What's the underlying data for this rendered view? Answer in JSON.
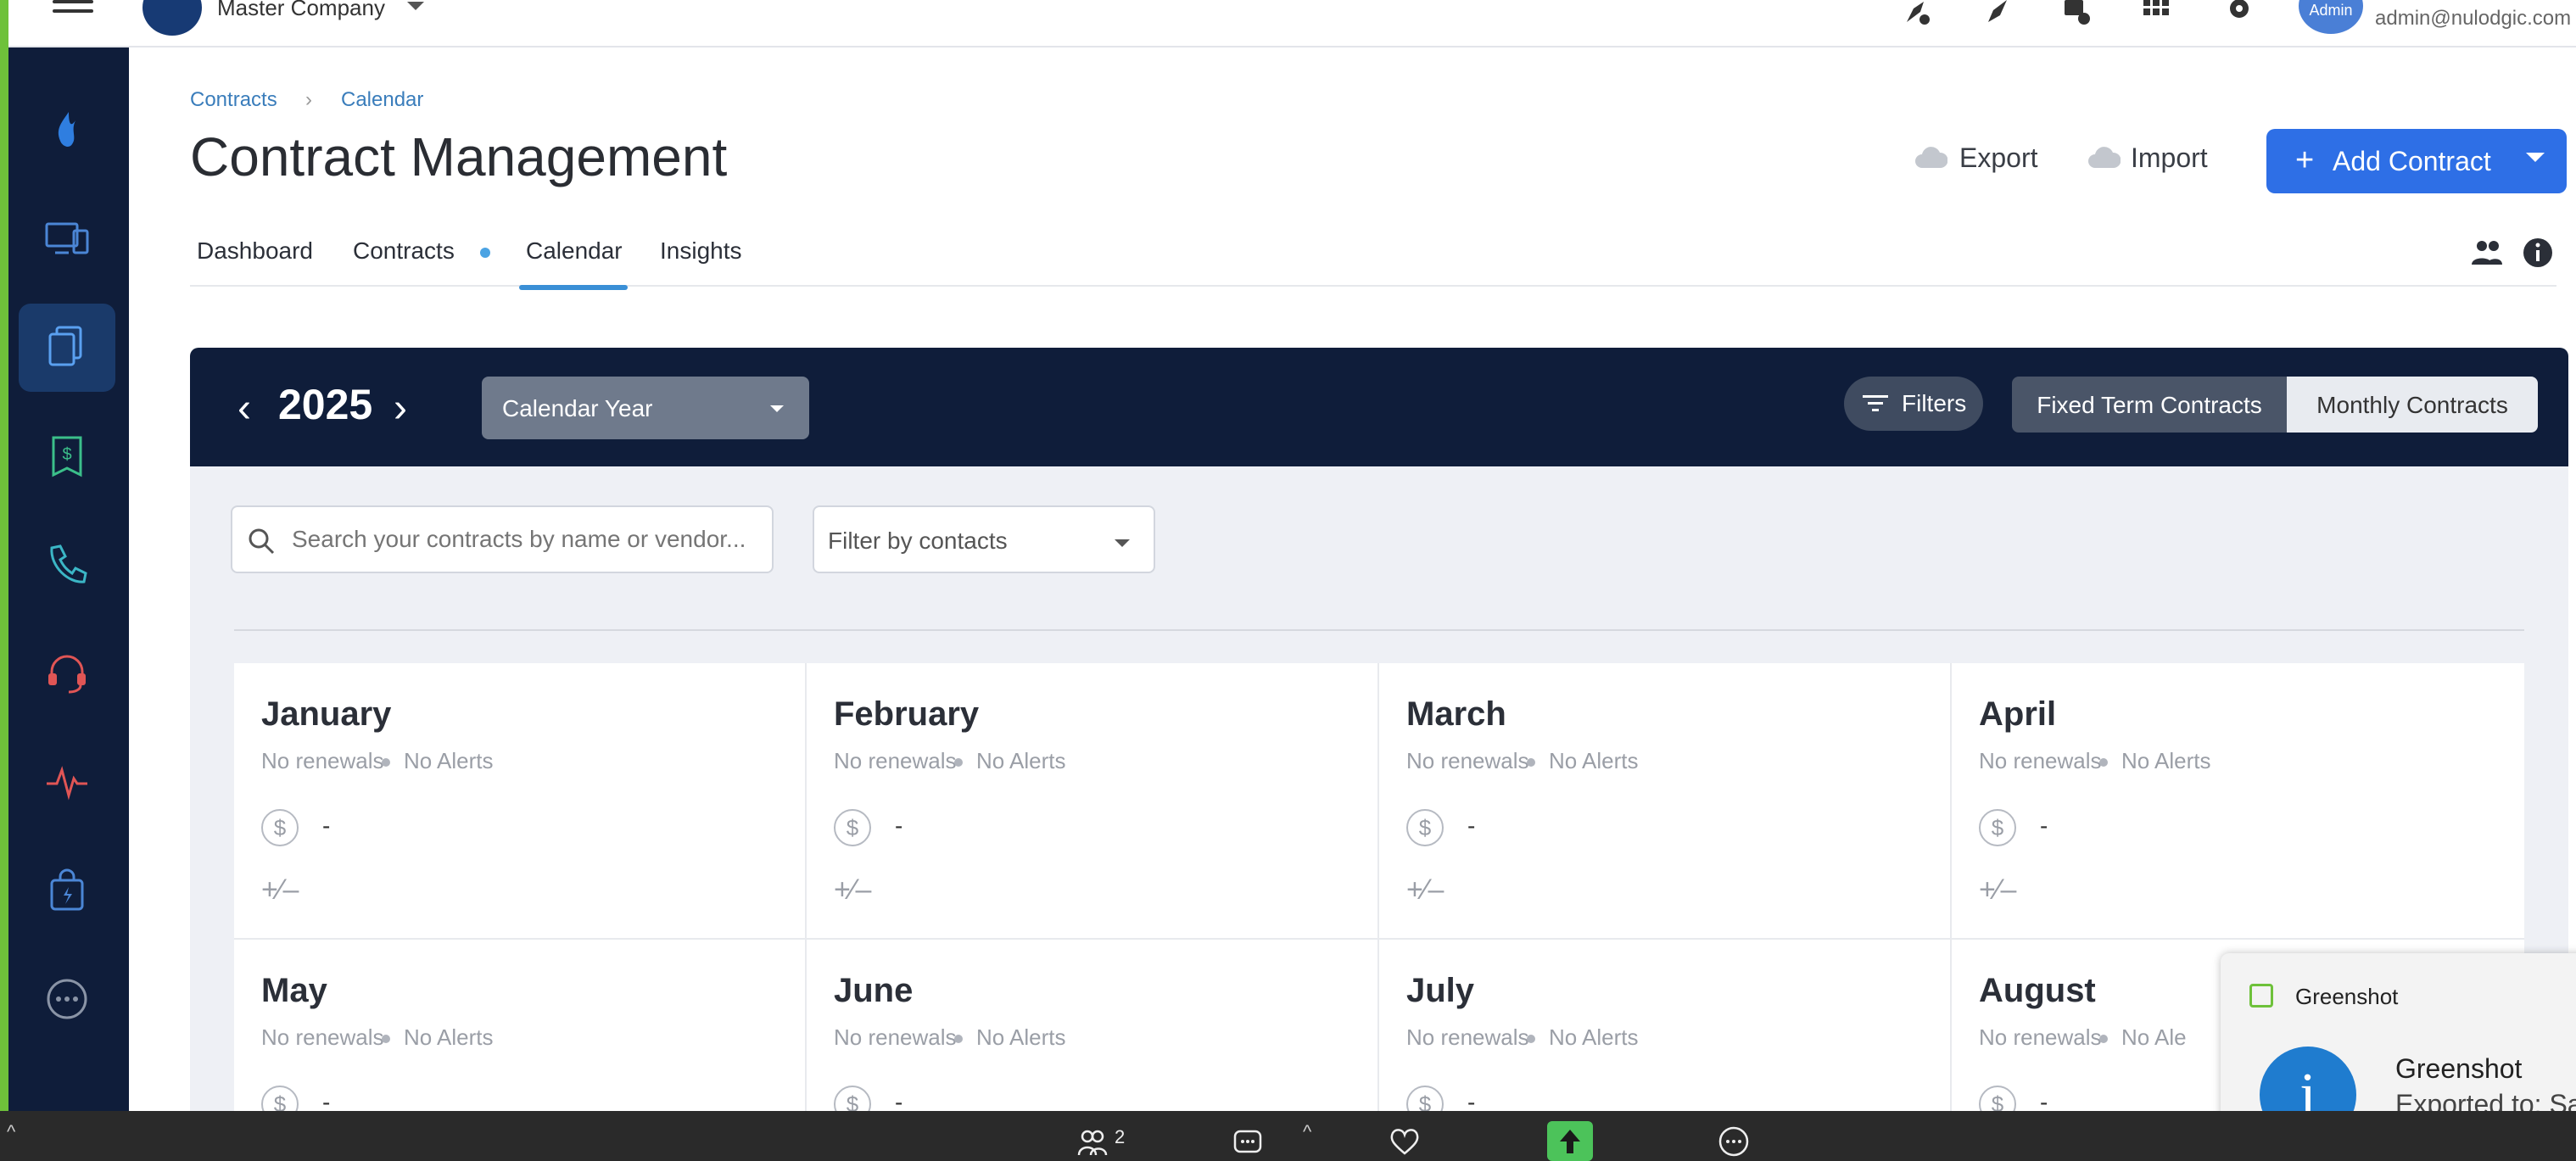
{
  "topbar": {
    "company_name": "Master Company",
    "avatar_label": "Admin",
    "user_email": "admin@nulodgic.com",
    "icons": [
      "rocket-alert-icon",
      "rocket-icon",
      "monitor-info-icon",
      "apps-grid-icon",
      "gear-icon"
    ]
  },
  "sidebar": {
    "items": [
      {
        "icon": "flame-logo-icon",
        "active": false
      },
      {
        "icon": "devices-icon",
        "active": false
      },
      {
        "icon": "documents-icon",
        "active": true
      },
      {
        "icon": "receipt-dollar-icon",
        "active": false
      },
      {
        "icon": "phone-icon",
        "active": false
      },
      {
        "icon": "headset-icon",
        "active": false
      },
      {
        "icon": "pulse-icon",
        "active": false
      },
      {
        "icon": "shopping-bag-icon",
        "active": false
      },
      {
        "icon": "more-icon",
        "active": false
      }
    ]
  },
  "breadcrumb": {
    "parent": "Contracts",
    "separator": "›",
    "current": "Calendar"
  },
  "page": {
    "title": "Contract Management",
    "export_label": "Export",
    "import_label": "Import",
    "add_label": "Add Contract",
    "add_plus": "+"
  },
  "tabs": [
    "Dashboard",
    "Contracts",
    "Calendar",
    "Insights"
  ],
  "active_tab": "Calendar",
  "calendar": {
    "year": "2025",
    "prev_label": "‹",
    "next_label": "›",
    "period": "Calendar Year",
    "filters_label": "Filters",
    "segment_fixed": "Fixed Term Contracts",
    "segment_monthly": "Monthly Contracts",
    "search_placeholder": "Search your contracts by name or vendor...",
    "contacts_placeholder": "Filter by contacts",
    "months": [
      {
        "name": "January",
        "renewals": "No renewals",
        "alerts": "No Alerts",
        "amount": "-",
        "change": "+⁄–"
      },
      {
        "name": "February",
        "renewals": "No renewals",
        "alerts": "No Alerts",
        "amount": "-",
        "change": "+⁄–"
      },
      {
        "name": "March",
        "renewals": "No renewals",
        "alerts": "No Alerts",
        "amount": "-",
        "change": "+⁄–"
      },
      {
        "name": "April",
        "renewals": "No renewals",
        "alerts": "No Alerts",
        "amount": "-",
        "change": "+⁄–"
      },
      {
        "name": "May",
        "renewals": "No renewals",
        "alerts": "No Alerts",
        "amount": "-",
        "change": "+⁄–"
      },
      {
        "name": "June",
        "renewals": "No renewals",
        "alerts": "No Alerts",
        "amount": "-",
        "change": "+⁄–"
      },
      {
        "name": "July",
        "renewals": "No renewals",
        "alerts": "No Alerts",
        "amount": "-",
        "change": "+⁄–"
      },
      {
        "name": "August",
        "renewals": "No renewals",
        "alerts": "No Ale",
        "amount": "-",
        "change": "+⁄–"
      }
    ]
  },
  "toast": {
    "app_name": "Greenshot",
    "title": "Greenshot",
    "body": "Exported to: Sa"
  },
  "bottombar": {
    "participants_count": "2"
  },
  "colors": {
    "sidebar_bg": "#0f1d3a",
    "primary": "#2e6fe6",
    "accent_strip": "#6ec13a",
    "tab_active": "#3a8fd6"
  }
}
